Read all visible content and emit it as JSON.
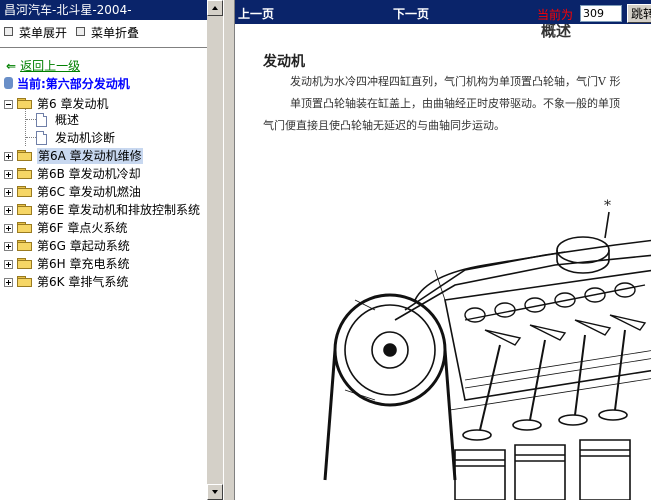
{
  "left_panel": {
    "title": "昌河汽车-北斗星-2004-",
    "expand_all": "菜单展开",
    "collapse_all": "菜单折叠",
    "back_link": "返回上一级",
    "current": "当前:第六部分发动机",
    "tree": [
      {
        "label": "第6 章发动机",
        "type": "folder",
        "expanded": true
      },
      {
        "label": "概述",
        "type": "doc"
      },
      {
        "label": "发动机诊断",
        "type": "doc"
      },
      {
        "label": "第6A 章发动机维修",
        "type": "folder",
        "selected": true
      },
      {
        "label": "第6B 章发动机冷却",
        "type": "folder"
      },
      {
        "label": "第6C 章发动机燃油",
        "type": "folder"
      },
      {
        "label": "第6E 章发动机和排放控制系统",
        "type": "folder"
      },
      {
        "label": "第6F 章点火系统",
        "type": "folder"
      },
      {
        "label": "第6G 章起动系统",
        "type": "folder"
      },
      {
        "label": "第6H 章充电系统",
        "type": "folder"
      },
      {
        "label": "第6K 章排气系统",
        "type": "folder"
      }
    ]
  },
  "toolbar": {
    "prev": "上一页",
    "next": "下一页",
    "current_label": "当前为",
    "page_value": "309",
    "jump": "跳转"
  },
  "document": {
    "top_heading": "概述",
    "section_title": "发动机",
    "lines": [
      "发动机为水冷四冲程四缸直列，气门机构为单顶置凸轮轴，气门V 形",
      "单顶置凸轮轴装在缸盖上，由曲轴经正时皮带驱动。不象一般的单顶",
      "气门便直接且使凸轮轴无延迟的与曲轴同步运动。"
    ],
    "figure_marker": "*"
  },
  "colors": {
    "title_bar": "#0a246a",
    "link_green": "#008000",
    "current_blue": "#0000ff",
    "label_red": "#ff0000",
    "selected_bg": "#c8d8f0",
    "chrome": "#d4d0c8"
  }
}
